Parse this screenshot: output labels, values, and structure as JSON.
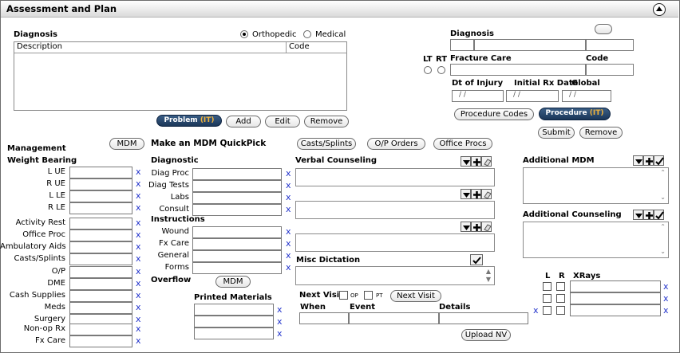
{
  "title": "Assessment and Plan",
  "diagnosis_left": {
    "label": "Diagnosis",
    "radio_ortho": "Orthopedic",
    "radio_medical": "Medical",
    "col_description": "Description",
    "col_code": "Code",
    "buttons": {
      "problemit": "Problem",
      "add": "Add",
      "edit": "Edit",
      "remove": "Remove"
    }
  },
  "diagnosis_right": {
    "label": "Diagnosis",
    "lt": "LT",
    "rt": "RT",
    "fracture_care": "Fracture Care",
    "code": "Code",
    "dt_injury": "Dt of Injury",
    "initial_rx": "Initial Rx Date",
    "global": "Global",
    "date_placeholder": "/ /",
    "procedure_codes": "Procedure Codes",
    "procedureit": "Procedure",
    "submit": "Submit",
    "remove": "Remove"
  },
  "management": {
    "heading": "Management",
    "weight_bearing": "Weight Bearing",
    "mdm_btn": "MDM",
    "wb_items": [
      "L UE",
      "R UE",
      "L LE",
      "R LE"
    ],
    "act_items": [
      "Activity Rest",
      "Office Proc",
      "Ambulatory Aids",
      "Casts/Splints",
      "O/P",
      "DME",
      "Cash Supplies",
      "Meds",
      "Surgery",
      "Non-op Rx",
      "Fx Care"
    ],
    "x": "x"
  },
  "quickpick": {
    "heading": "Make an MDM QuickPick",
    "diagnostic": "Diagnostic",
    "diag_items": [
      "Diag Proc",
      "Diag Tests",
      "Labs",
      "Consult"
    ],
    "instructions": "Instructions",
    "instr_items": [
      "Wound",
      "Fx Care",
      "General",
      "Forms"
    ],
    "overflow": "Overflow",
    "overflow_mdm": "MDM",
    "printed_materials": "Printed Materials"
  },
  "counseling": {
    "casts_splints": "Casts/Splints",
    "op_orders": "O/P Orders",
    "office_procs": "Office Procs",
    "verbal_counseling": "Verbal Counseling",
    "misc_dictation": "Misc Dictation",
    "next_visit": "Next Visit",
    "op": "OP",
    "pt": "PT",
    "next_visit_btn": "Next Visit",
    "col_when": "When",
    "col_event": "Event",
    "col_details": "Details",
    "upload_nv": "Upload NV"
  },
  "additional": {
    "additional_mdm": "Additional MDM",
    "additional_counseling": "Additional Counseling"
  },
  "xrays": {
    "l": "L",
    "r": "R",
    "heading": "XRays",
    "x": "x"
  }
}
